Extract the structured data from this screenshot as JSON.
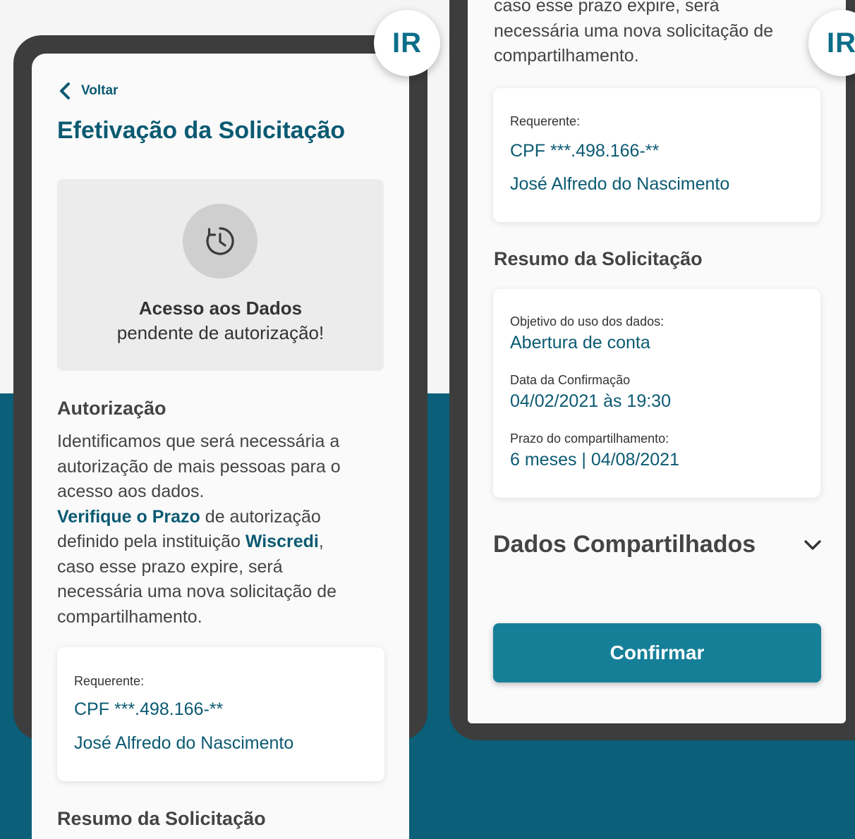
{
  "badge_label": "IR",
  "left_screen": {
    "back_label": "Voltar",
    "title": "Efetivação da Solicitação",
    "status": {
      "icon": "clock-history-icon",
      "title": "Acesso aos Dados",
      "subtitle": "pendente de autorização!"
    },
    "autorizacao": {
      "heading": "Autorização",
      "line1": "Identificamos que será necessária a",
      "line2": "autorização de mais pessoas para o",
      "line3": "acesso aos dados.",
      "prazo_link": "Verifique o Prazo",
      "line4_rest": " de autorização",
      "line5_start": "definido pela instituição ",
      "institution": "Wiscredi",
      "line5_end": ",",
      "line6": "caso esse prazo expire, será",
      "line7": "necessária uma nova solicitação de",
      "line8": "compartilhamento."
    },
    "requerente": {
      "label": "Requerente:",
      "cpf": "CPF ***.498.166-**",
      "name": "José Alfredo do Nascimento"
    },
    "resumo_heading": "Resumo da Solicitação"
  },
  "right_screen": {
    "top_text": {
      "line1": "caso esse prazo expire, será",
      "line2": "necessária uma nova solicitação de",
      "line3": "compartilhamento."
    },
    "requerente": {
      "label": "Requerente:",
      "cpf": "CPF ***.498.166-**",
      "name": "José Alfredo do Nascimento"
    },
    "resumo_heading": "Resumo da Solicitação",
    "resumo": {
      "objetivo_label": "Objetivo do uso dos dados:",
      "objetivo_value": "Abertura de conta",
      "data_label": "Data da Confirmação",
      "data_value": "04/02/2021 às 19:30",
      "prazo_label": "Prazo do compartilhamento:",
      "prazo_value": "6 meses | 04/08/2021"
    },
    "dados_compartilhados": "Dados Compartilhados",
    "confirm_label": "Confirmar"
  },
  "colors": {
    "brand_dark": "#0b5a72",
    "brand_button": "#167f98",
    "background_band": "#0b5f78",
    "phone_frame": "#3d3d3d"
  }
}
